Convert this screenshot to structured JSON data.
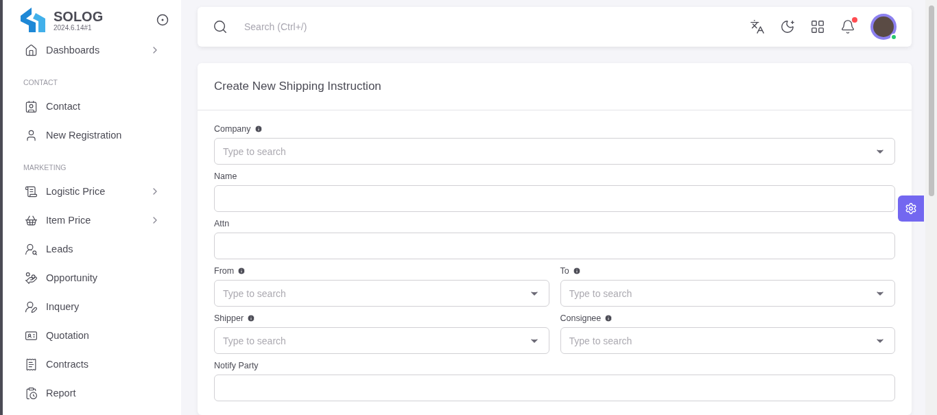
{
  "brand": {
    "name": "SOLOG",
    "version": "2024.6.14#1"
  },
  "sidebar": {
    "items": [
      {
        "kind": "item",
        "label": "Dashboards",
        "has_children": true
      },
      {
        "kind": "header",
        "label": "CONTACT"
      },
      {
        "kind": "item",
        "label": "Contact",
        "has_children": false
      },
      {
        "kind": "item",
        "label": "New Registration",
        "has_children": false
      },
      {
        "kind": "header",
        "label": "MARKETING"
      },
      {
        "kind": "item",
        "label": "Logistic Price",
        "has_children": true
      },
      {
        "kind": "item",
        "label": "Item Price",
        "has_children": true
      },
      {
        "kind": "item",
        "label": "Leads",
        "has_children": false
      },
      {
        "kind": "item",
        "label": "Opportunity",
        "has_children": false
      },
      {
        "kind": "item",
        "label": "Inquery",
        "has_children": false
      },
      {
        "kind": "item",
        "label": "Quotation",
        "has_children": false
      },
      {
        "kind": "item",
        "label": "Contracts",
        "has_children": false
      },
      {
        "kind": "item",
        "label": "Report",
        "has_children": false
      }
    ]
  },
  "search": {
    "placeholder": "Search (Ctrl+/)"
  },
  "notifications": {
    "unread": true
  },
  "user": {
    "online": true
  },
  "form": {
    "title": "Create New Shipping Instruction",
    "rows": [
      {
        "fields": [
          {
            "label": "Company",
            "info": true,
            "kind": "select",
            "placeholder": "Type to search"
          }
        ]
      },
      {
        "fields": [
          {
            "label": "Name",
            "info": false,
            "kind": "text"
          }
        ]
      },
      {
        "fields": [
          {
            "label": "Attn",
            "info": false,
            "kind": "text"
          }
        ]
      },
      {
        "fields": [
          {
            "label": "From",
            "info": true,
            "kind": "select",
            "placeholder": "Type to search"
          },
          {
            "label": "To",
            "info": true,
            "kind": "select",
            "placeholder": "Type to search"
          }
        ]
      },
      {
        "fields": [
          {
            "label": "Shipper",
            "info": true,
            "kind": "select",
            "placeholder": "Type to search"
          },
          {
            "label": "Consignee",
            "info": true,
            "kind": "select",
            "placeholder": "Type to search"
          }
        ]
      },
      {
        "fields": [
          {
            "label": "Notify Party",
            "info": false,
            "kind": "text"
          }
        ]
      }
    ]
  }
}
